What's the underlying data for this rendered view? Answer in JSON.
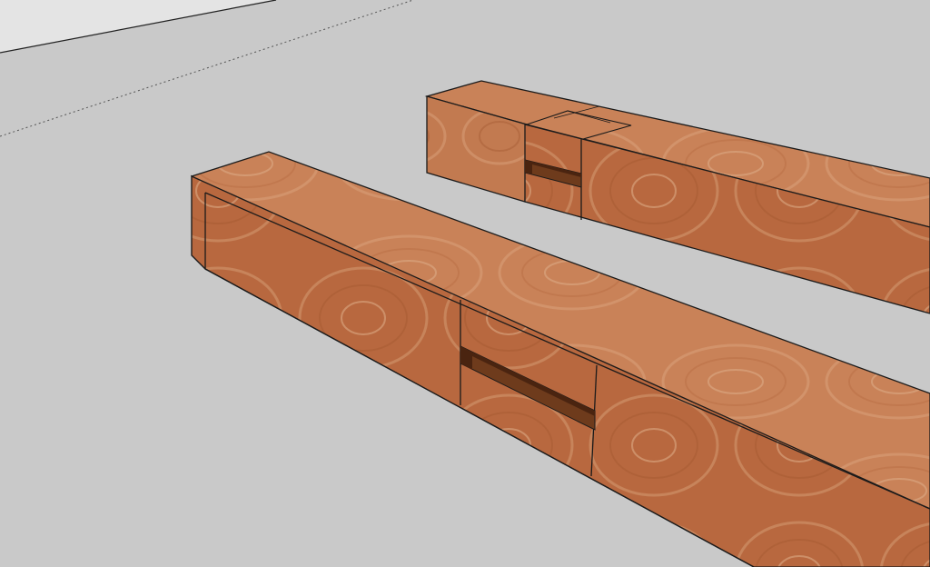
{
  "viewport": {
    "ground_color": "#c9c9c9",
    "sky_color": "#e4e4e4",
    "edge_color": "#1a1a1a"
  },
  "model": {
    "wood_top_color": "#c98258",
    "wood_side_color": "#b8683f",
    "wood_end_color": "#c27a50",
    "mortise_color": "#6e3b1c",
    "mortise_shadow_color": "#4a2410"
  }
}
